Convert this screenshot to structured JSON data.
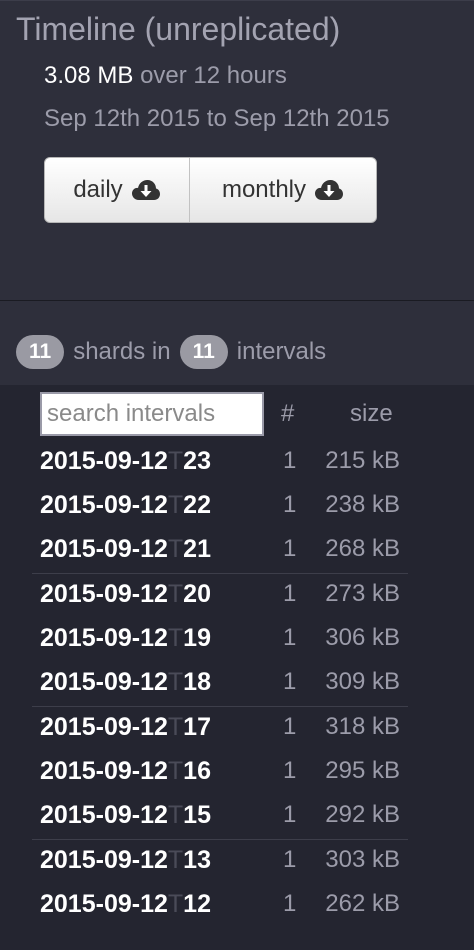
{
  "header": {
    "title": "Timeline (unreplicated)",
    "total_size": "3.08 MB",
    "duration": "over 12 hours",
    "date_range": "Sep 12th 2015 to Sep 12th 2015"
  },
  "downloads": {
    "daily_label": "daily",
    "monthly_label": "monthly"
  },
  "summary": {
    "shard_count": "11",
    "shards_text": "shards in",
    "interval_count": "11",
    "intervals_text": "intervals"
  },
  "table": {
    "search_placeholder": "search intervals",
    "col_count": "#",
    "col_size": "size",
    "rows": [
      {
        "date": "2015-09-12",
        "sep": "T",
        "hour": "23",
        "count": "1",
        "size": "215 kB"
      },
      {
        "date": "2015-09-12",
        "sep": "T",
        "hour": "22",
        "count": "1",
        "size": "238 kB"
      },
      {
        "date": "2015-09-12",
        "sep": "T",
        "hour": "21",
        "count": "1",
        "size": "268 kB"
      },
      {
        "date": "2015-09-12",
        "sep": "T",
        "hour": "20",
        "count": "1",
        "size": "273 kB"
      },
      {
        "date": "2015-09-12",
        "sep": "T",
        "hour": "19",
        "count": "1",
        "size": "306 kB"
      },
      {
        "date": "2015-09-12",
        "sep": "T",
        "hour": "18",
        "count": "1",
        "size": "309 kB"
      },
      {
        "date": "2015-09-12",
        "sep": "T",
        "hour": "17",
        "count": "1",
        "size": "318 kB"
      },
      {
        "date": "2015-09-12",
        "sep": "T",
        "hour": "16",
        "count": "1",
        "size": "295 kB"
      },
      {
        "date": "2015-09-12",
        "sep": "T",
        "hour": "15",
        "count": "1",
        "size": "292 kB"
      },
      {
        "date": "2015-09-12",
        "sep": "T",
        "hour": "13",
        "count": "1",
        "size": "303 kB"
      },
      {
        "date": "2015-09-12",
        "sep": "T",
        "hour": "12",
        "count": "1",
        "size": "262 kB"
      }
    ]
  },
  "icons": {
    "download": "cloud-download-icon"
  }
}
